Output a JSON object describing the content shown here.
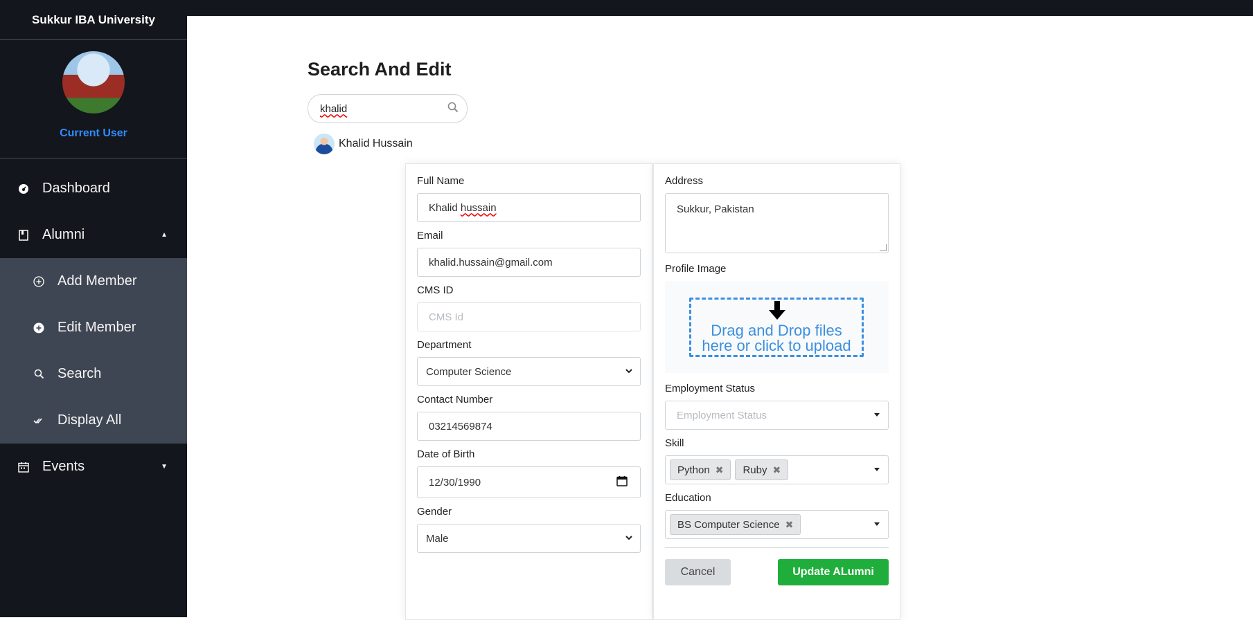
{
  "sidebar": {
    "brand": "Sukkur IBA University",
    "current_user": "Current User",
    "nav": {
      "dashboard": "Dashboard",
      "alumni": "Alumni",
      "add_member": "Add Member",
      "edit_member": "Edit Member",
      "search": "Search",
      "display_all": "Display All",
      "events": "Events"
    }
  },
  "page": {
    "title": "Search And Edit",
    "search_value": "khalid",
    "result_name": "Khalid Hussain"
  },
  "form": {
    "full_name_label": "Full Name",
    "full_name_first": "Khalid",
    "full_name_last": "hussain",
    "email_label": "Email",
    "email": "khalid.hussain@gmail.com",
    "cms_label": "CMS ID",
    "cms_placeholder": "CMS Id",
    "department_label": "Department",
    "department": "Computer Science",
    "contact_label": "Contact Number",
    "contact": "03214569874",
    "dob_label": "Date of Birth",
    "dob": "12/30/1990",
    "gender_label": "Gender",
    "gender": "Male",
    "address_label": "Address",
    "address": "Sukkur, Pakistan",
    "profile_label": "Profile Image",
    "drop_line1": "Drag and Drop files",
    "drop_line2": "here or click to upload",
    "employment_label": "Employment Status",
    "employment_placeholder": "Employment Status",
    "skill_label": "Skill",
    "skills": [
      "Python",
      "Ruby"
    ],
    "education_label": "Education",
    "education": [
      "BS Computer Science"
    ],
    "cancel": "Cancel",
    "update": "Update ALumni"
  },
  "colors": {
    "sidebar_bg": "#13161c",
    "submenu_bg": "#3f4653",
    "accent_blue": "#2f8bff",
    "update_green": "#1fae3b",
    "drop_blue": "#3b8fe0"
  }
}
